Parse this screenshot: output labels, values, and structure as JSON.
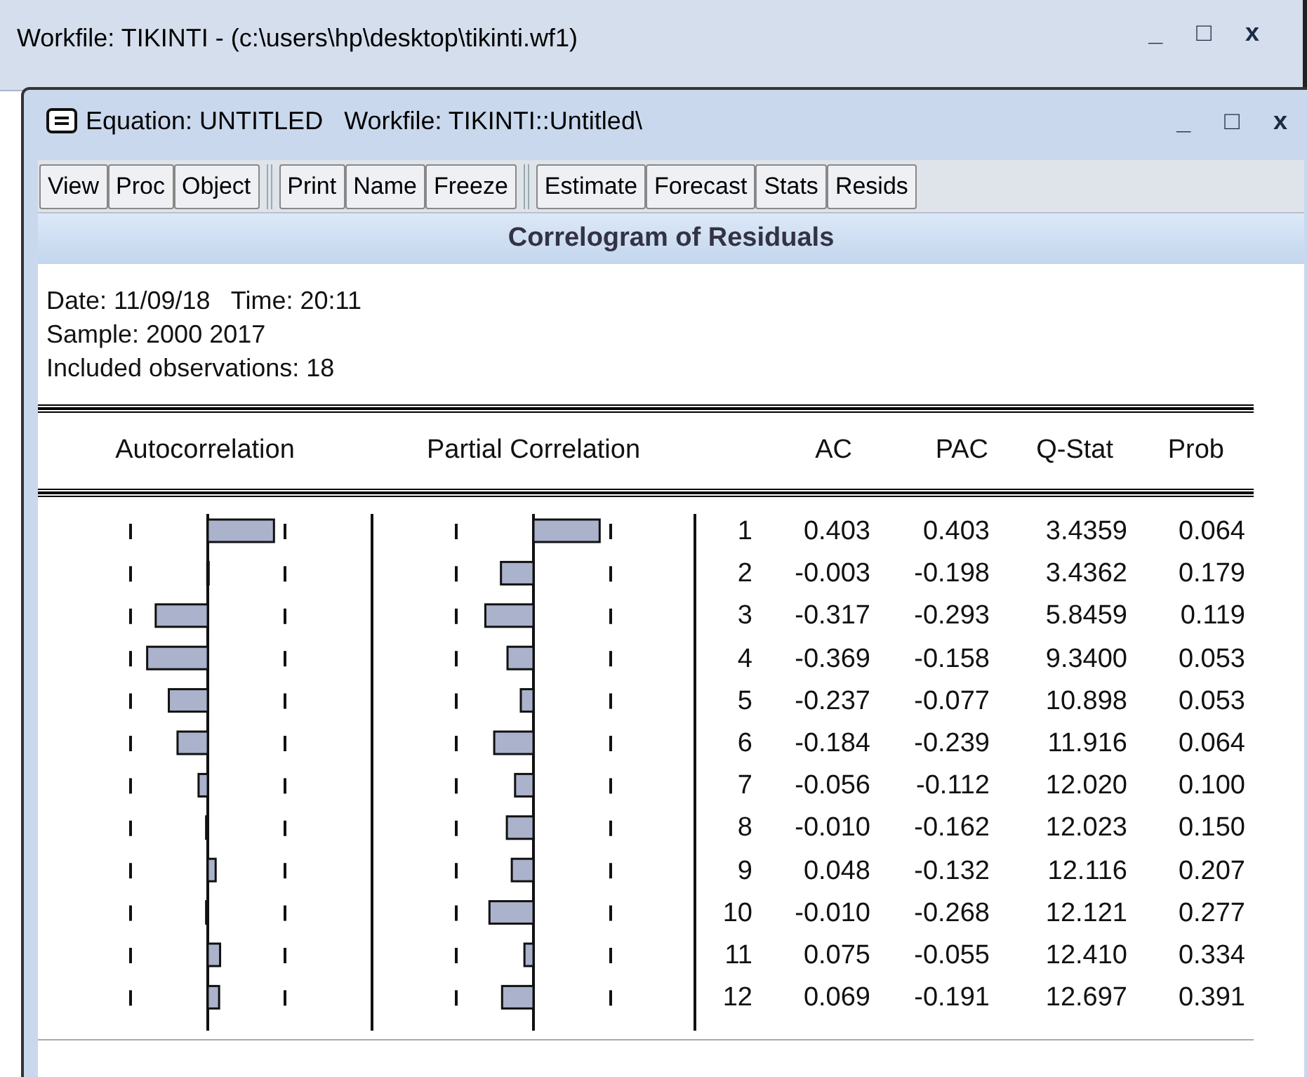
{
  "outer_window": {
    "title": "Workfile: TIKINTI - (c:\\users\\hp\\desktop\\tikinti.wf1)",
    "controls": [
      "_",
      "□",
      "x"
    ]
  },
  "window": {
    "title": "Equation: UNTITLED   Workfile: TIKINTI::Untitled\\",
    "controls": [
      "_",
      "□",
      "x"
    ]
  },
  "toolbar": [
    [
      "View",
      "Proc",
      "Object"
    ],
    [
      "Print",
      "Name",
      "Freeze"
    ],
    [
      "Estimate",
      "Forecast",
      "Stats",
      "Resids"
    ]
  ],
  "view_title": "Correlogram of Residuals",
  "info": [
    "Date: 11/09/18   Time: 20:11",
    "Sample: 2000 2017",
    "Included observations: 18"
  ],
  "table": {
    "columns": [
      "Autocorrelation",
      "Partial Correlation",
      "AC",
      "PAC",
      "Q-Stat",
      "Prob"
    ],
    "rows": [
      {
        "lag": "1",
        "ac": "0.403",
        "pac": "0.403",
        "q_stat": "3.4359",
        "prob": "0.064"
      },
      {
        "lag": "2",
        "ac": "-0.003",
        "pac": "-0.198",
        "q_stat": "3.4362",
        "prob": "0.179"
      },
      {
        "lag": "3",
        "ac": "-0.317",
        "pac": "-0.293",
        "q_stat": "5.8459",
        "prob": "0.119"
      },
      {
        "lag": "4",
        "ac": "-0.369",
        "pac": "-0.158",
        "q_stat": "9.3400",
        "prob": "0.053"
      },
      {
        "lag": "5",
        "ac": "-0.237",
        "pac": "-0.077",
        "q_stat": "10.898",
        "prob": "0.053"
      },
      {
        "lag": "6",
        "ac": "-0.184",
        "pac": "-0.239",
        "q_stat": "11.916",
        "prob": "0.064"
      },
      {
        "lag": "7",
        "ac": "-0.056",
        "pac": "-0.112",
        "q_stat": "12.020",
        "prob": "0.100"
      },
      {
        "lag": "8",
        "ac": "-0.010",
        "pac": "-0.162",
        "q_stat": "12.023",
        "prob": "0.150"
      },
      {
        "lag": "9",
        "ac": "0.048",
        "pac": "-0.132",
        "q_stat": "12.116",
        "prob": "0.207"
      },
      {
        "lag": "10",
        "ac": "-0.010",
        "pac": "-0.268",
        "q_stat": "12.121",
        "prob": "0.277"
      },
      {
        "lag": "11",
        "ac": "0.075",
        "pac": "-0.055",
        "q_stat": "12.410",
        "prob": "0.334"
      },
      {
        "lag": "12",
        "ac": "0.069",
        "pac": "-0.191",
        "q_stat": "12.697",
        "prob": "0.391"
      }
    ]
  }
}
